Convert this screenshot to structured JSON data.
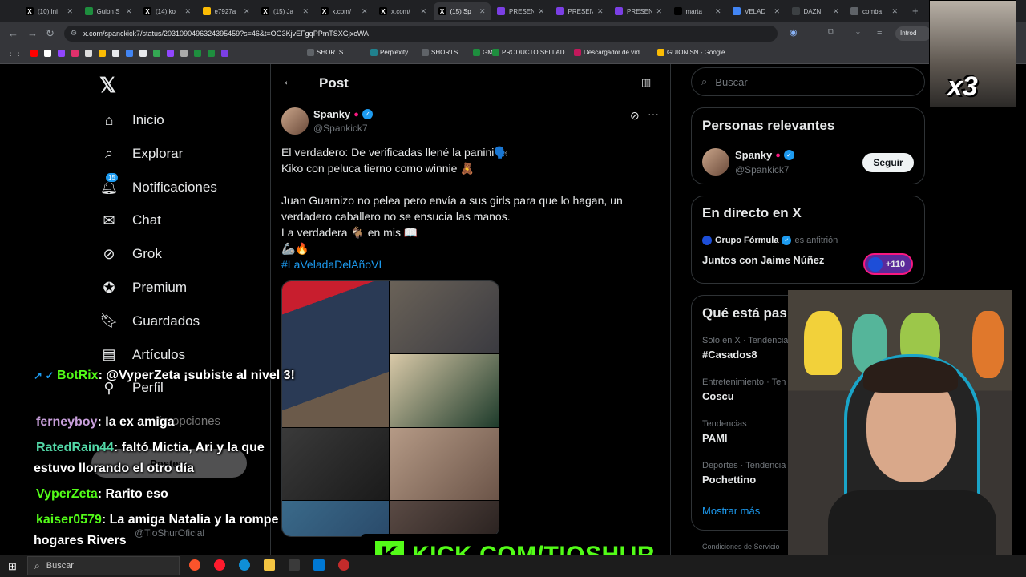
{
  "browser": {
    "tabs": [
      {
        "title": "(10) Ini",
        "icon": "x-logo-icon",
        "color": "#000000"
      },
      {
        "title": "Guion S",
        "icon": "sheets-icon",
        "color": "#1e8e3e"
      },
      {
        "title": "(14) ko",
        "icon": "x-logo-icon",
        "color": "#000000"
      },
      {
        "title": "e7927a",
        "icon": "drive-icon",
        "color": "#fbbc04"
      },
      {
        "title": "(15) Ja",
        "icon": "x-logo-icon",
        "color": "#000000"
      },
      {
        "title": "x.com/",
        "icon": "x-logo-icon",
        "color": "#000000"
      },
      {
        "title": "x.com/",
        "icon": "x-logo-icon",
        "color": "#000000"
      },
      {
        "title": "(15) Sp",
        "icon": "x-logo-icon",
        "color": "#000000"
      },
      {
        "title": "PRESEN",
        "icon": "slides-icon",
        "color": "#7b3fe4"
      },
      {
        "title": "PRESEN",
        "icon": "slides-icon",
        "color": "#7b3fe4"
      },
      {
        "title": "PRESEN",
        "icon": "slides-icon",
        "color": "#7b3fe4"
      },
      {
        "title": "marta",
        "icon": "tiktok-icon",
        "color": "#000000"
      },
      {
        "title": "VELAD",
        "icon": "chrome-icon",
        "color": "#4285f4"
      },
      {
        "title": "DAZN",
        "icon": "grid-icon",
        "color": "#3c4043"
      },
      {
        "title": "comba",
        "icon": "globe-icon",
        "color": "#5f6368"
      }
    ],
    "active_tab": 7,
    "url": "x.com/spanckick7/status/2031090496324395459?s=46&t=OG3KjvEFgqPPmTSXGjxcWA",
    "profile_label": "Introd",
    "bookmarks": [
      {
        "label": "SHORTS",
        "color": "#5f6368"
      },
      {
        "label": "Perplexity",
        "color": "#20808d"
      },
      {
        "label": "SHORTS",
        "color": "#5f6368"
      },
      {
        "label": "GM",
        "color": "#1e8e3e"
      },
      {
        "label": "PRODUCTO SELLAD...",
        "color": "#1e8e3e"
      },
      {
        "label": "Descargador de víd...",
        "color": "#c2185b"
      },
      {
        "label": "GUION SN - Google...",
        "color": "#fbbc04"
      }
    ]
  },
  "nav": {
    "items": [
      {
        "label": "Inicio",
        "icon": "home-icon"
      },
      {
        "label": "Explorar",
        "icon": "search-icon"
      },
      {
        "label": "Notificaciones",
        "icon": "bell-icon",
        "badge": "15"
      },
      {
        "label": "Chat",
        "icon": "mail-icon"
      },
      {
        "label": "Grok",
        "icon": "grok-icon"
      },
      {
        "label": "Premium",
        "icon": "verified-icon"
      },
      {
        "label": "Guardados",
        "icon": "bookmark-icon"
      },
      {
        "label": "Artículos",
        "icon": "article-icon"
      },
      {
        "label": "Perfil",
        "icon": "person-icon"
      }
    ],
    "partial_more": "ás opciones",
    "post_button": "Postear",
    "account_handle": "@TioShurOficial"
  },
  "post": {
    "header_title": "Post",
    "author_name": "Spanky",
    "author_handle": "@Spankick7",
    "text_lines": [
      "El verdadero: De verificadas llené la panini🗣️",
      "Kiko con peluca tierno como winnie 🧸",
      "",
      "Juan Guarnizo no pelea pero envía a sus girls para que lo hagan, un",
      "verdadero caballero no se ensucia las manos.",
      "La verdadera 🐐 en mis 📖",
      "🦾🔥"
    ],
    "hashtag": "#LaVeladaDelAñoVI"
  },
  "sidebar": {
    "search_placeholder": "Buscar",
    "relevant_title": "Personas relevantes",
    "relevant_name": "Spanky",
    "relevant_handle": "@Spankick7",
    "follow_label": "Seguir",
    "live_title": "En directo en X",
    "live_host": "Grupo Fórmula",
    "live_host_suffix": "es anfitrión",
    "live_space_title": "Juntos con Jaime Núñez",
    "live_count": "+110",
    "trends_title": "Qué está pas",
    "trends": [
      {
        "category": "Solo en X · Tendencia",
        "name": "#Casados8"
      },
      {
        "category": "Entretenimiento · Ten",
        "name": "Coscu"
      },
      {
        "category": "Tendencias",
        "name": "PAMI"
      },
      {
        "category": "Deportes · Tendencia",
        "name": "Pochettino"
      }
    ],
    "show_more": "Mostrar más",
    "footer": "Condiciones de Servicio"
  },
  "stream_overlay": {
    "chat": [
      {
        "user": "BotRix",
        "user_color": "#53fc18",
        "text": ": @VyperZeta ¡subiste al nivel 3!"
      },
      {
        "user": "ferneyboy",
        "user_color": "#c9a0dc",
        "text": ": la ex amiga"
      },
      {
        "user": "RatedRain44",
        "user_color": "#53d9a8",
        "text": ": faltó Mictia, Ari y la que estuvo llorando el otro día"
      },
      {
        "user": "VyperZeta",
        "user_color": "#53fc18",
        "text": ": Rarito eso"
      },
      {
        "user": "kaiser0579",
        "user_color": "#53fc18",
        "text": ": La amiga Natalia y la rompe hogares Rivers"
      }
    ],
    "kick_url": "KICK.COM/TIOSHUR",
    "meme_label": "x3"
  },
  "taskbar": {
    "search_label": "Buscar"
  },
  "colors": {
    "accent": "#1d9bf0",
    "kick_green": "#53fc18",
    "bg": "#000000",
    "border": "#2f3336"
  }
}
